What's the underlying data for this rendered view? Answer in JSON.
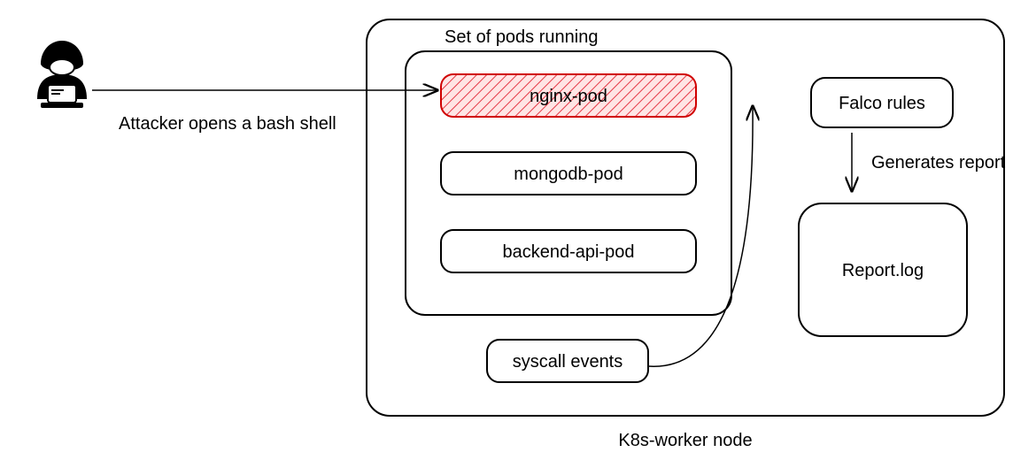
{
  "attacker_label": "Attacker opens a bash shell",
  "node_label": "K8s-worker node",
  "pods": {
    "title": "Set of pods running",
    "items": [
      "nginx-pod",
      "mongodb-pod",
      "backend-api-pod"
    ],
    "compromised_index": 0
  },
  "syscall_label": "syscall events",
  "falco_label": "Falco rules",
  "generates_label": "Generates report",
  "report_label": "Report.log"
}
